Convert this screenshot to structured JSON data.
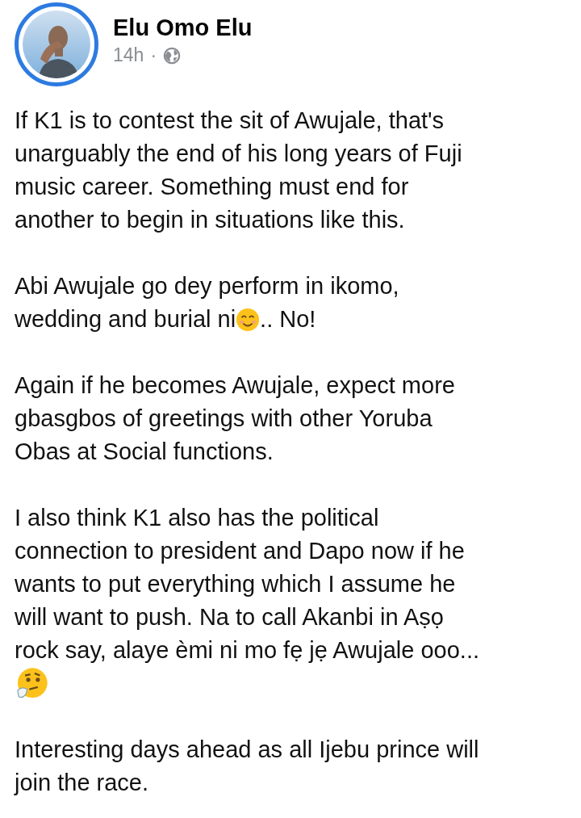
{
  "post": {
    "author": "Elu Omo Elu",
    "time": "14h",
    "separator": "·",
    "paragraphs": [
      {
        "lines": [
          {
            "parts": [
              {
                "kind": "text",
                "text": "If K1 is to contest the sit of Awujale, that's"
              }
            ]
          },
          {
            "parts": [
              {
                "kind": "text",
                "text": "unarguably the end of his long years of Fuji"
              }
            ]
          },
          {
            "parts": [
              {
                "kind": "text",
                "text": "music career. Something must end for"
              }
            ]
          },
          {
            "parts": [
              {
                "kind": "text",
                "text": "another to begin in situations like this."
              }
            ]
          }
        ]
      },
      {
        "lines": [
          {
            "parts": [
              {
                "kind": "text",
                "text": "Abi Awujale go dey perform in ikomo,"
              }
            ]
          },
          {
            "parts": [
              {
                "kind": "text",
                "text": "wedding and burial ni"
              },
              {
                "kind": "smile"
              },
              {
                "kind": "text",
                "text": ".. No!"
              }
            ]
          }
        ]
      },
      {
        "lines": [
          {
            "parts": [
              {
                "kind": "text",
                "text": "Again if he becomes Awujale, expect more"
              }
            ]
          },
          {
            "parts": [
              {
                "kind": "text",
                "text": "gbasgbos of greetings with other Yoruba"
              }
            ]
          },
          {
            "parts": [
              {
                "kind": "text",
                "text": "Obas at Social functions."
              }
            ]
          }
        ]
      },
      {
        "lines": [
          {
            "parts": [
              {
                "kind": "text",
                "text": "I also think K1 also has the political"
              }
            ]
          },
          {
            "parts": [
              {
                "kind": "text",
                "text": "connection to president and Dapo now if he"
              }
            ]
          },
          {
            "parts": [
              {
                "kind": "text",
                "text": "wants to put everything which I assume he"
              }
            ]
          },
          {
            "parts": [
              {
                "kind": "text",
                "text": "will want to push. Na to call Akanbi in Aṣọ"
              }
            ]
          },
          {
            "parts": [
              {
                "kind": "text",
                "text": "rock say, alaye èmi ni mo fẹ jẹ Awujale ooo..."
              }
            ]
          },
          {
            "parts": [
              {
                "kind": "thinking"
              }
            ]
          }
        ]
      },
      {
        "lines": [
          {
            "parts": [
              {
                "kind": "text",
                "text": "Interesting days ahead as all Ijebu prince will"
              }
            ]
          },
          {
            "parts": [
              {
                "kind": "text",
                "text": "join the race."
              }
            ]
          }
        ]
      }
    ]
  }
}
